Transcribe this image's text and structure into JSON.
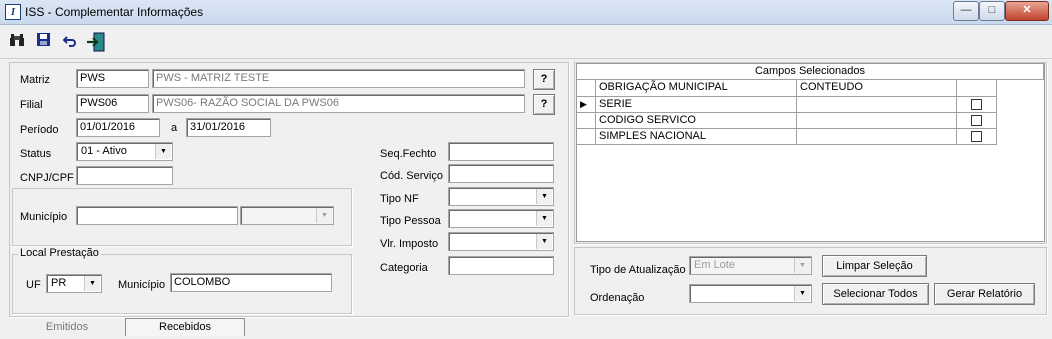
{
  "window": {
    "title": "ISS - Complementar Informações",
    "icon_letter": "I",
    "controls": {
      "minimize": "—",
      "maximize": "□",
      "close": "✕"
    }
  },
  "toolbar": {
    "icons": [
      "binoculars-icon",
      "save-icon",
      "undo-icon",
      "exit-icon"
    ]
  },
  "form": {
    "matriz": {
      "label": "Matriz",
      "code": "PWS",
      "name": "PWS - MATRIZ TESTE",
      "lookup": "?"
    },
    "filial": {
      "label": "Filial",
      "code": "PWS06",
      "name": "PWS06- RAZÃO SOCIAL DA PWS06",
      "lookup": "?"
    },
    "periodo": {
      "label": "Período",
      "start": "01/01/2016",
      "sep": "a",
      "end": "31/01/2016"
    },
    "status": {
      "label": "Status",
      "value": "01 - Ativo"
    },
    "cnpj": {
      "label": "CNPJ/CPF",
      "value": ""
    },
    "municipio": {
      "label": "Município",
      "value": "",
      "uf": ""
    },
    "local_prestacao": {
      "title": "Local Prestação",
      "uf_label": "UF",
      "uf_value": "PR",
      "municipio_label": "Município",
      "municipio_value": "COLOMBO"
    }
  },
  "middle": {
    "seq_fechto": {
      "label": "Seq.Fechto",
      "value": ""
    },
    "cod_servico": {
      "label": "Cód. Serviço",
      "value": ""
    },
    "tipo_nf": {
      "label": "Tipo NF",
      "value": ""
    },
    "tipo_pessoa": {
      "label": "Tipo Pessoa",
      "value": ""
    },
    "vlr_imposto": {
      "label": "Vlr. Imposto",
      "value": ""
    },
    "categoria": {
      "label": "Categoria",
      "value": ""
    }
  },
  "grid": {
    "title": "Campos Selecionados",
    "columns": [
      "OBRIGAÇÃO MUNICIPAL",
      "CONTEUDO",
      ""
    ],
    "rows": [
      {
        "indicator": "▶",
        "obrigacao": "SERIE",
        "conteudo": "",
        "checked": false
      },
      {
        "indicator": "",
        "obrigacao": "CODIGO SERVICO",
        "conteudo": "",
        "checked": false
      },
      {
        "indicator": "",
        "obrigacao": "SIMPLES NACIONAL",
        "conteudo": "",
        "checked": false
      }
    ]
  },
  "bottom_right": {
    "tipo_atualizacao": {
      "label": "Tipo de Atualização",
      "value": "Em Lote"
    },
    "ordenacao": {
      "label": "Ordenação",
      "value": ""
    },
    "buttons": {
      "limpar": "Limpar Seleção",
      "selecionar": "Selecionar Todos",
      "gerar": "Gerar Relatório"
    }
  },
  "tabs": [
    {
      "label": "Emitidos",
      "active": false
    },
    {
      "label": "Recebidos",
      "active": true
    }
  ]
}
